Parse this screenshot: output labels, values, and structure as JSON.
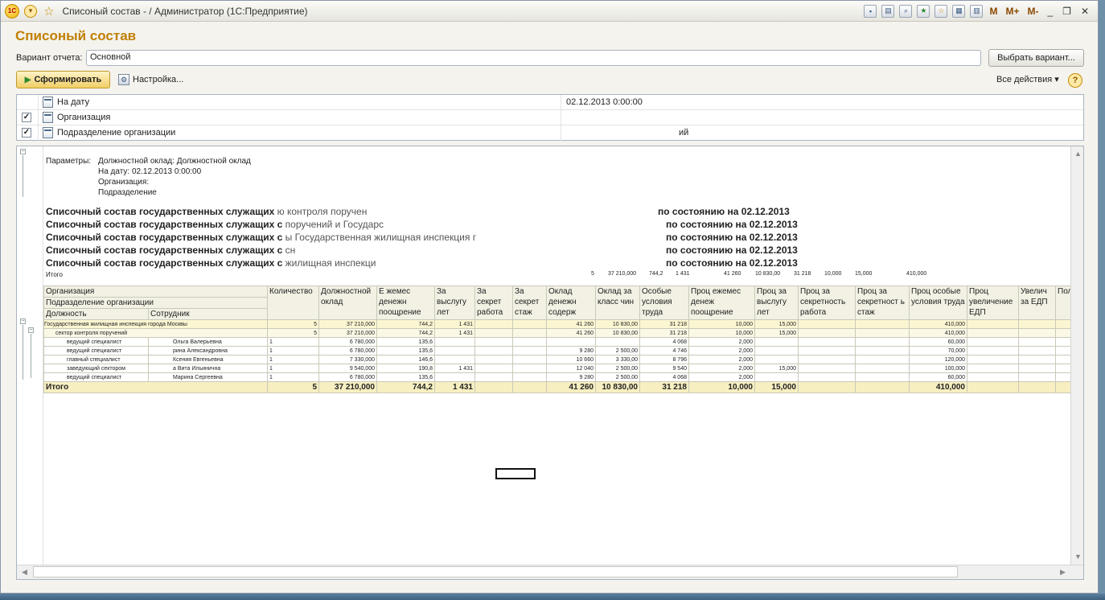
{
  "window": {
    "title": "Списоный состав - / Администратор  (1С:Предприятие)",
    "logo": "1С",
    "toolbar_right": {
      "m": "M",
      "mplus": "M+",
      "mminus": "M-"
    }
  },
  "form": {
    "title": "Списоный состав",
    "variant_label": "Вариант отчета:",
    "variant_value": "Основной",
    "choose_variant": "Выбрать вариант...",
    "generate": "Сформировать",
    "settings": "Настройка...",
    "all_actions": "Все действия",
    "help": "?"
  },
  "filters": [
    {
      "label": "На дату",
      "checked": false,
      "value": "02.12.2013 0:00:00"
    },
    {
      "label": "Организация",
      "checked": true,
      "value": ""
    },
    {
      "label": "Подразделение организации",
      "checked": true,
      "value": "ий"
    }
  ],
  "report": {
    "params_label": "Параметры:",
    "params": [
      "Должностной оклад: Должностной оклад",
      "На дату: 02.12.2013 0:00:00",
      "Организация:",
      "Подразделение"
    ],
    "headings": [
      {
        "left": "Списочный состав государственных служащих",
        "mid": "ю контроля поручен",
        "right": "по состоянию на 02.12.2013"
      },
      {
        "left": "Списочный состав государственных служащих с",
        "mid": "поручений и Государс",
        "right": "по состоянию на 02.12.2013"
      },
      {
        "left": "Списочный состав государственных служащих с",
        "mid": "ы Государственная жилищная инспекция г",
        "right": "по состоянию на 02.12.2013"
      },
      {
        "left": "Списочный состав государственных служащих с",
        "mid": "сн",
        "right": "по состоянию на 02.12.2013"
      },
      {
        "left": "Списочный состав государственных служащих с",
        "mid": "жилищная инспекци",
        "right": "по состоянию на 02.12.2013"
      }
    ],
    "itogo_small": "Итого",
    "itogo_small_values": [
      "5",
      "37 210,000",
      "744,2",
      "1 431",
      "41 260",
      "10 830,00",
      "31 218",
      "10,000",
      "15,000",
      "410,000"
    ],
    "columns_header": {
      "org": "Организация",
      "dept": "Подразделение организации",
      "position": "Должность",
      "employee": "Сотрудник",
      "cols": [
        "Количество",
        "Должностной оклад",
        "Е жемес денежн поощрение",
        "За выслугу лет",
        "За секрет работа",
        "За секрет стаж",
        "Оклад денежн содерж",
        "Оклад за класс чин",
        "Особые условия труда",
        "Проц ежемес денеж поощрение",
        "Проц за выслугу лет",
        "Проц за секретность работа",
        "Проц за секретност ь стаж",
        "Проц особые условия труда",
        "Проц увеличение ЕДП",
        "Увелич за ЕДП",
        "Пол"
      ]
    },
    "rows": [
      {
        "type": "group",
        "name": "Государственная жилищная инспекция города Москвы",
        "emp": "",
        "vals": [
          "5",
          "37 210,000",
          "744,2",
          "1 431",
          "",
          "",
          "41 260",
          "10 830,00",
          "31 218",
          "10,000",
          "15,000",
          "",
          "",
          "410,000",
          "",
          "",
          ""
        ]
      },
      {
        "type": "sub",
        "name": "сектор контроля поручений",
        "emp": "",
        "vals": [
          "5",
          "37 210,000",
          "744,2",
          "1 431",
          "",
          "",
          "41 260",
          "10 830,00",
          "31 218",
          "10,000",
          "15,000",
          "",
          "",
          "410,000",
          "",
          "",
          ""
        ]
      },
      {
        "type": "item",
        "name": "ведущий специалист",
        "emp": "Ольга Валерьевна",
        "vals": [
          "1",
          "6 780,000",
          "135,6",
          "",
          "",
          "",
          "",
          "",
          "4 068",
          "2,000",
          "",
          "",
          "",
          "60,000",
          "",
          "",
          ""
        ]
      },
      {
        "type": "item",
        "name": "ведущий специалист",
        "emp": "рина Александровна",
        "vals": [
          "1",
          "6 780,000",
          "135,6",
          "",
          "",
          "",
          "9 280",
          "2 500,00",
          "4 746",
          "2,000",
          "",
          "",
          "",
          "70,000",
          "",
          "",
          ""
        ]
      },
      {
        "type": "item",
        "name": "главный специалист",
        "emp": "Ксения Евгеньевна",
        "vals": [
          "1",
          "7 330,000",
          "146,6",
          "",
          "",
          "",
          "10 660",
          "3 330,00",
          "8 796",
          "2,000",
          "",
          "",
          "",
          "120,000",
          "",
          "",
          ""
        ]
      },
      {
        "type": "item",
        "name": "заведующий сектором",
        "emp": "а Вита Ильинична",
        "vals": [
          "1",
          "9 540,000",
          "190,8",
          "1 431",
          "",
          "",
          "12 040",
          "2 500,00",
          "9 540",
          "2,000",
          "15,000",
          "",
          "",
          "100,000",
          "",
          "",
          ""
        ]
      },
      {
        "type": "item",
        "name": "ведущий специалист",
        "emp": "Марина Сергеевна",
        "vals": [
          "1",
          "6 780,000",
          "135,6",
          "",
          "",
          "",
          "9 280",
          "2 500,00",
          "4 068",
          "2,000",
          "",
          "",
          "",
          "60,000",
          "",
          "",
          ""
        ]
      }
    ],
    "total": {
      "label": "Итого",
      "vals": [
        "5",
        "37 210,000",
        "744,2",
        "1 431",
        "",
        "",
        "41 260",
        "10 830,00",
        "31 218",
        "10,000",
        "15,000",
        "",
        "",
        "410,000",
        "",
        "",
        ""
      ]
    }
  }
}
